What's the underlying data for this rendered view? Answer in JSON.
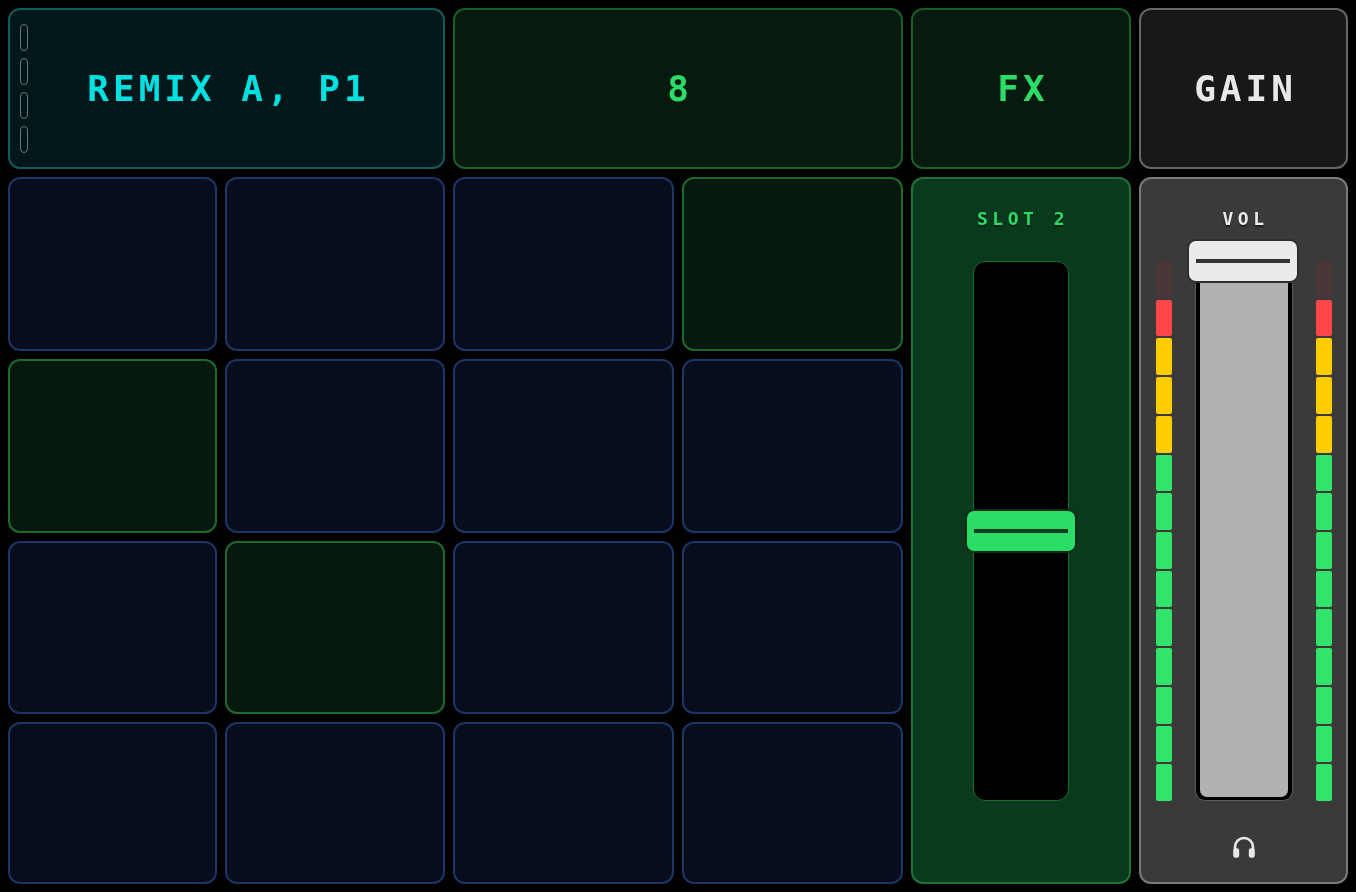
{
  "header": {
    "indicators": [
      {
        "on": false
      },
      {
        "on": false
      },
      {
        "on": false
      },
      {
        "on": false
      }
    ],
    "title": "REMIX A, P1",
    "counter": "8",
    "fx_button": {
      "label": "FX"
    },
    "gain_button": {
      "label": "GAIN"
    }
  },
  "pads": [
    {
      "lit": false
    },
    {
      "lit": false
    },
    {
      "lit": false
    },
    {
      "lit": true
    },
    {
      "lit": true
    },
    {
      "lit": false
    },
    {
      "lit": false
    },
    {
      "lit": false
    },
    {
      "lit": false
    },
    {
      "lit": true
    },
    {
      "lit": false
    },
    {
      "lit": false
    },
    {
      "lit": false
    },
    {
      "lit": false
    },
    {
      "lit": false
    },
    {
      "lit": false
    }
  ],
  "slot_fader": {
    "label": "SLOT 2",
    "level": 0.5
  },
  "volume_fader": {
    "label": "VOL",
    "level": 1,
    "meters": [
      {
        "level": 0.93
      },
      {
        "level": 0.93
      }
    ]
  }
}
